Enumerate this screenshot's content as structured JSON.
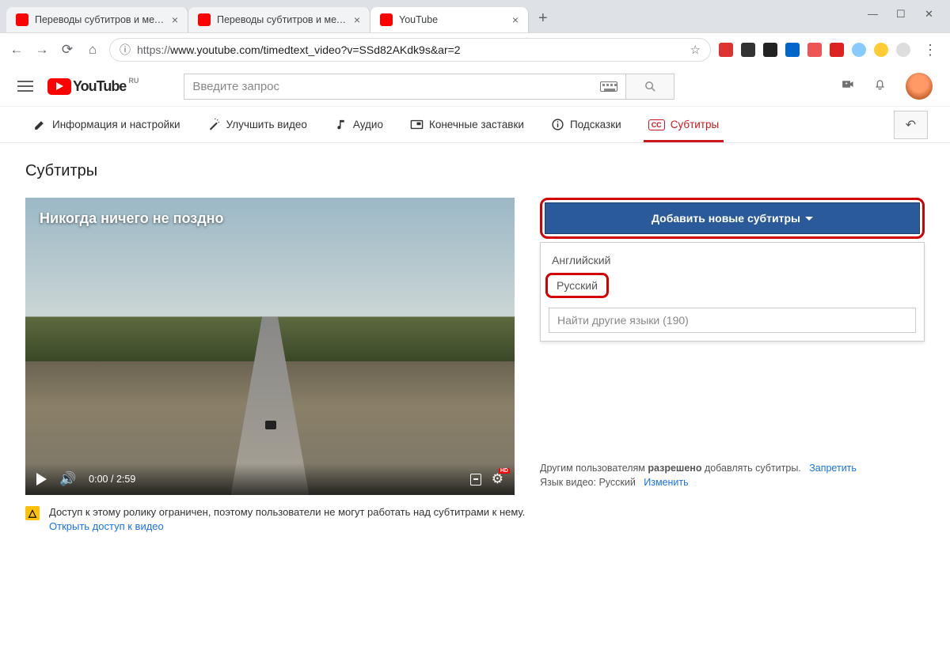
{
  "browser": {
    "tabs": [
      {
        "title": "Переводы субтитров и метадан…",
        "favicon": "#ff0000"
      },
      {
        "title": "Переводы субтитров и метадан…",
        "favicon": "#ff0000"
      },
      {
        "title": "YouTube",
        "favicon": "#ff0000",
        "active": true
      }
    ],
    "url_prefix": "https://",
    "url": "www.youtube.com/timedtext_video?v=SSd82AKdk9s&ar=2"
  },
  "yt_header": {
    "logo_text": "YouTube",
    "logo_region": "RU",
    "search_placeholder": "Введите запрос"
  },
  "studio_tabs": {
    "info": "Информация и настройки",
    "enhance": "Улучшить видео",
    "audio": "Аудио",
    "endscreens": "Конечные заставки",
    "cards": "Подсказки",
    "subtitles": "Субтитры"
  },
  "page": {
    "title": "Субтитры"
  },
  "video": {
    "overlay_title": "Никогда ничего не поздно",
    "current_time": "0:00",
    "duration": "2:59",
    "hd_badge": "HD"
  },
  "subtitle_panel": {
    "add_button": "Добавить новые субтитры",
    "lang_english": "Английский",
    "lang_russian": "Русский",
    "search_placeholder": "Найти другие языки (190)",
    "footer_line1_a": "Другим пользователям ",
    "footer_line1_b": "разрешено",
    "footer_line1_c": " добавлять субтитры.",
    "footer_disallow": "Запретить",
    "footer_line2": "Язык видео: Русский",
    "footer_change": "Изменить"
  },
  "warning": {
    "text": "Доступ к этому ролику ограничен, поэтому пользователи не могут работать над субтитрами к нему.",
    "link": "Открыть доступ к видео"
  }
}
